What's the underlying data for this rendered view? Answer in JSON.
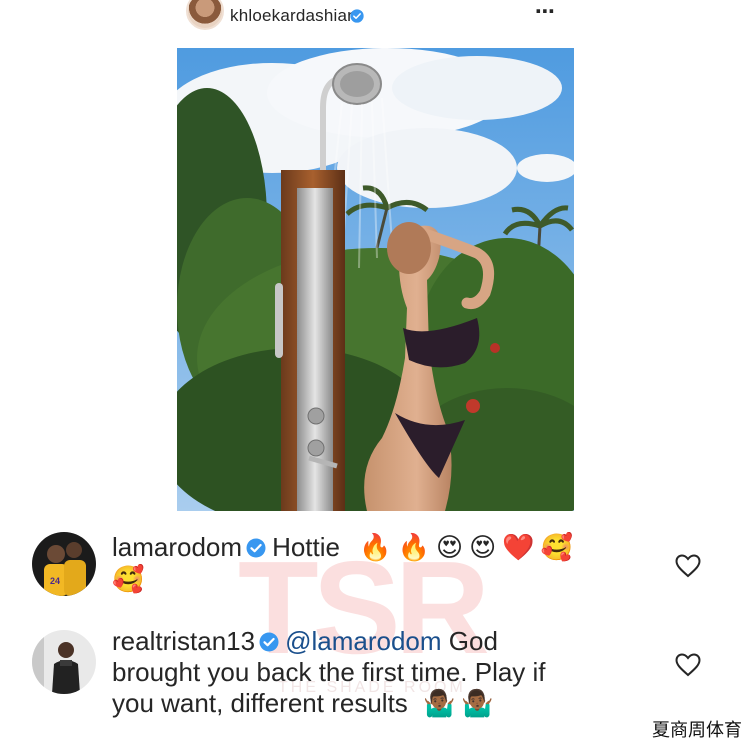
{
  "post": {
    "username": "khloekardashian",
    "more_icon": "⋯"
  },
  "comments": [
    {
      "username": "lamarodom",
      "text": "Hottie",
      "emojis": [
        "🔥",
        "🔥",
        "😍",
        "😍",
        "❤️",
        "🥰",
        "🥰"
      ]
    },
    {
      "username": "realtristan13",
      "mention": "@lamarodom",
      "text_line1": "God",
      "text_line2": "brought you back the first time. Play if",
      "text_line3": "you want, different results",
      "emojis": [
        "🤷🏾‍♂️",
        "🤷🏾‍♂️"
      ]
    }
  ],
  "watermark": {
    "letters": "TSR",
    "tagline": "THE SHADE ROOM"
  },
  "source_caption": "夏商周体育",
  "colors": {
    "verified_blue": "#3897f0",
    "text": "#262626",
    "mention": "#1a4f8c"
  }
}
